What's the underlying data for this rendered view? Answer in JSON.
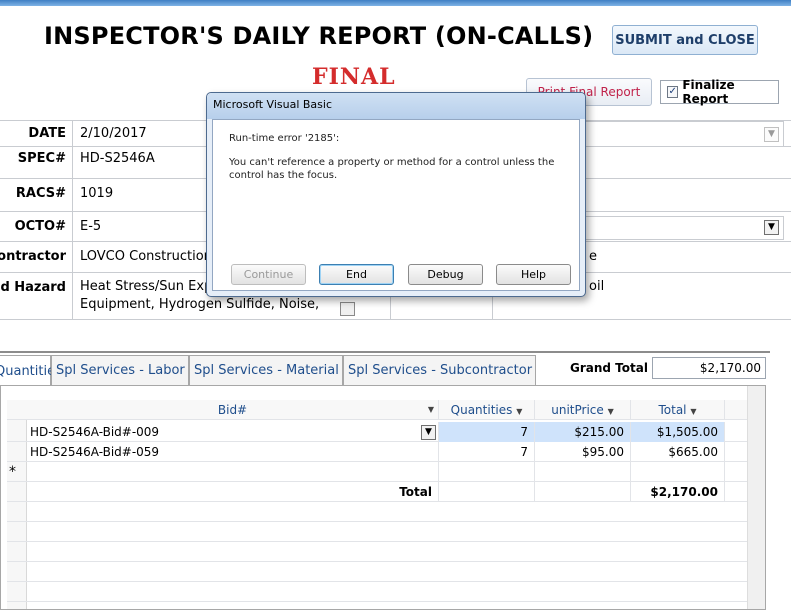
{
  "header": {
    "title": "INSPECTOR'S DAILY REPORT (ON-CALLS)",
    "status_stamp": "FINAL",
    "submit_button": "SUBMIT and CLOSE",
    "print_button": "Print Final Report",
    "finalize_label": "Finalize Report",
    "finalize_checked": "✓"
  },
  "form": {
    "date_label": "DATE",
    "date_value": "2/10/2017",
    "spec_label": "SPEC#",
    "spec_value": "HD-S2546A",
    "racs_label": "RACS#",
    "racs_value": "1019",
    "octo_label": "OCTO#",
    "octo_value": "E-5",
    "contractor_label": "Contractor",
    "contractor_value": "LOVCO Construction",
    "hazard_label": "Field Hazard",
    "hazard_value_line1": "Heat Stress/Sun Exposure,",
    "hazard_value_line2": "Equipment, Hydrogen Sulfide, Noise,",
    "right_col_line1": "e",
    "right_col_line2": "oil"
  },
  "tabs": {
    "items": [
      "Quantities",
      "Spl Services - Labor",
      "Spl Services - Material",
      "Spl Services - Subcontractor"
    ],
    "active": "Quantities"
  },
  "grand_total": {
    "label": "Grand Total",
    "value": "$2,170.00"
  },
  "datasheet": {
    "columns": [
      "Bid#",
      "Quantities",
      "unitPrice",
      "Total"
    ],
    "rows": [
      {
        "bid": "HD-S2546A-Bid#-009",
        "qty": "7",
        "unit_price": "$215.00",
        "total": "$1,505.00"
      },
      {
        "bid": "HD-S2546A-Bid#-059",
        "qty": "7",
        "unit_price": "$95.00",
        "total": "$665.00"
      }
    ],
    "new_record_marker": "*",
    "total_label": "Total",
    "total_value": "$2,170.00"
  },
  "dialog": {
    "title": "Microsoft Visual Basic",
    "error_line": "Run-time error '2185':",
    "message": "You can't reference a property or method for a control unless the control has the focus.",
    "buttons": [
      "Continue",
      "End",
      "Debug",
      "Help"
    ]
  },
  "colors": {
    "final_red": "#d42c2c",
    "accent_blue": "#1f4e8c",
    "selected_row": "#cfe3fb"
  }
}
